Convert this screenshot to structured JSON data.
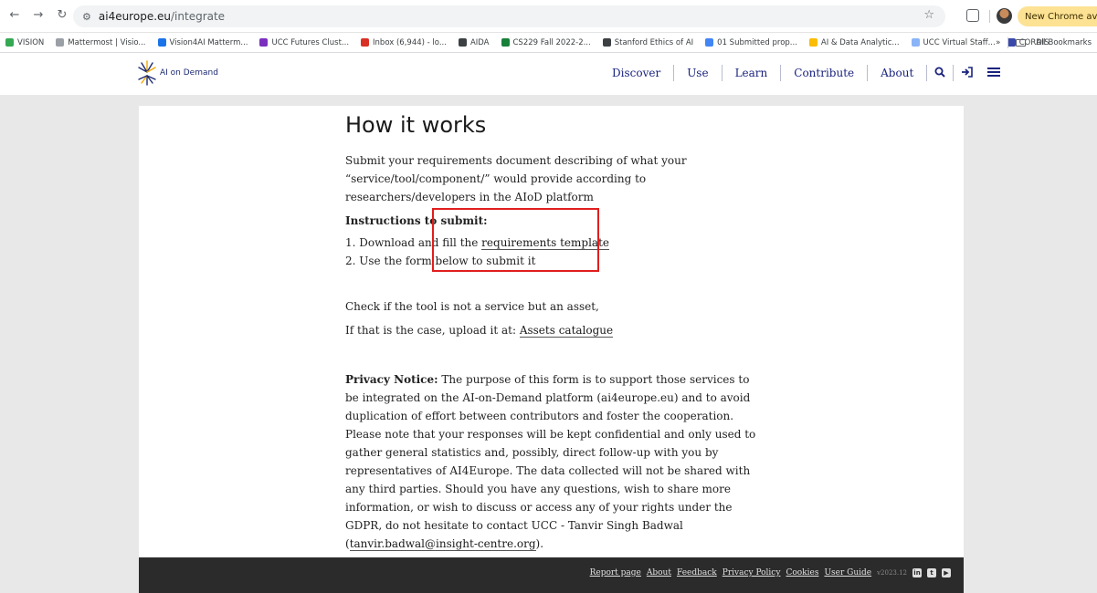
{
  "browser": {
    "url_host": "ai4europe.eu",
    "url_path": "/integrate",
    "new_chrome_label": "New Chrome available",
    "bookmarks": [
      {
        "label": "VISION",
        "color": "#34a853"
      },
      {
        "label": "Mattermost | Visio...",
        "color": "#9aa0a6"
      },
      {
        "label": "Vision4AI Matterm...",
        "color": "#1a73e8"
      },
      {
        "label": "UCC Futures Clust...",
        "color": "#7b2fbf"
      },
      {
        "label": "Inbox (6,944) - lo...",
        "color": "#d93025"
      },
      {
        "label": "AIDA",
        "color": "#3c4043"
      },
      {
        "label": "CS229 Fall 2022-2...",
        "color": "#188038"
      },
      {
        "label": "Stanford Ethics of AI",
        "color": "#3c4043"
      },
      {
        "label": "01 Submitted prop...",
        "color": "#4285f4"
      },
      {
        "label": "AI & Data Analytic...",
        "color": "#fbbc04"
      },
      {
        "label": "UCC Virtual Staff...",
        "color": "#8ab4f8"
      },
      {
        "label": "CORDIS",
        "color": "#3949ab"
      }
    ],
    "all_bookmarks_label": "All Bookmarks"
  },
  "site": {
    "logo_text_prefix": "AI ",
    "logo_text_on": "on",
    "logo_text_suffix": " Demand",
    "nav": [
      "Discover",
      "Use",
      "Learn",
      "Contribute",
      "About"
    ]
  },
  "main": {
    "title": "How it works",
    "intro": "Submit your requirements document describing of what your “service/tool/component/” would provide according to researchers/developers in the AIoD platform",
    "instructions_heading": "Instructions to submit:",
    "step1_prefix": "1. Download and fill the ",
    "step1_link": "requirements template",
    "step2": "2. Use the form below to submit it",
    "asset_line1": "Check if the tool is not a service but an asset,",
    "asset_line2_prefix": "If that is the case, upload it at: ",
    "asset_link": "Assets catalogue",
    "privacy_label": "Privacy Notice:",
    "privacy_text": " The purpose of this form is to support those services to be integrated on the AI-on-Demand platform (ai4europe.eu) and to avoid duplication of effort between contributors and foster the cooperation. Please note that your responses will be kept confidential and only used to gather general statistics and, possibly, direct follow-up with you by representatives of AI4Europe. The data collected will not be shared with any third parties. Should you have any questions, wish to share more information, or wish to discuss or access any of your rights under the GDPR, do not hesitate to contact UCC - Tanvir Singh Badwal (",
    "privacy_email": "tanvir.badwal@insight-centre.org",
    "privacy_end": ")."
  },
  "footer": {
    "links": [
      "Report page",
      "About",
      "Feedback",
      "Privacy Policy",
      "Cookies",
      "User Guide"
    ],
    "version": "v2023.12"
  },
  "colors": {
    "nav_text": "#1a237e",
    "highlight": "#e01e1e",
    "footer_bg": "#2b2b2b"
  }
}
